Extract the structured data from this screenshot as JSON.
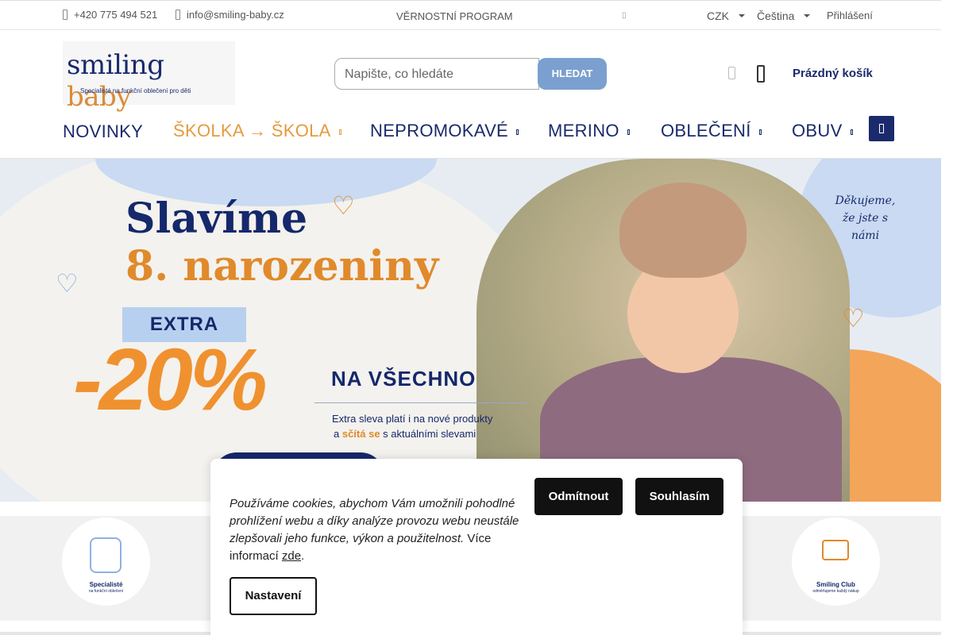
{
  "topbar": {
    "phone": "+420 775 494 521",
    "email": "info@smiling-baby.cz",
    "loyalty": "VĚRNOSTNÍ PROGRAM",
    "currency": "CZK",
    "language": "Čeština",
    "login": "Přihlášení"
  },
  "logo": {
    "word1": "smiling",
    "word2": "baby",
    "tagline": "Specialisté na funkční oblečení pro děti"
  },
  "search": {
    "placeholder": "Napište, co hledáte",
    "button": "HLEDAT"
  },
  "cart": {
    "label": "Prázdný košík"
  },
  "nav": {
    "items": [
      {
        "label": "NOVINKY"
      },
      {
        "label": "ŠKOLKA → ŠKOLA"
      },
      {
        "label": "NEPROMOKAVÉ"
      },
      {
        "label": "MERINO"
      },
      {
        "label": "OBLEČENÍ"
      },
      {
        "label": "OBUV"
      }
    ]
  },
  "hero": {
    "title1": "Slavíme",
    "title2": "8. narozeniny",
    "extra": "EXTRA",
    "percent": "-20%",
    "headline": "NA VŠECHNO",
    "sub1": "Extra sleva platí i na nové produkty",
    "sub2_a": "a ",
    "sub2_b": "sčítá se",
    "sub2_c": " s aktuálními slevami",
    "thanks": "Děkujeme, že jste s námi"
  },
  "badges": [
    {
      "title": "Specialisté",
      "subtitle": "na funkční oblečení"
    },
    {
      "title": "Smiling Club",
      "subtitle": "odměňujeme každý nákup"
    }
  ],
  "cookie": {
    "message": "Používáme cookies, abychom Vám umožnili pohodlné prohlížení webu a díky analýze provozu webu neustále zlepšovali jeho funkce, výkon a použitelnost.",
    "more": "Více informací",
    "link": "zde",
    "period": ".",
    "reject": "Odmítnout",
    "accept": "Souhlasím",
    "settings": "Nastavení"
  },
  "colors": {
    "brand_navy": "#1a2a6c",
    "brand_orange": "#e59a3e",
    "search_button": "#7ba0cf"
  }
}
